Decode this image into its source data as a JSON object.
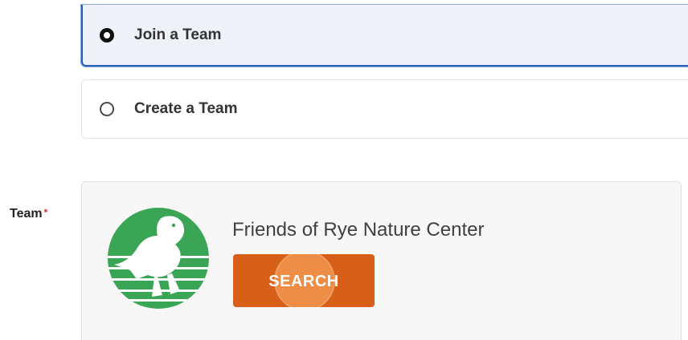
{
  "team_type": {
    "options": [
      {
        "label": "Join a Team",
        "selected": true
      },
      {
        "label": "Create a Team",
        "selected": false
      }
    ]
  },
  "team_field": {
    "label": "Team",
    "required_marker": "*",
    "team_name": "Friends of Rye Nature Center",
    "logo_icon": "bird-on-striped-circle-logo",
    "search_label": "SEARCH"
  },
  "colors": {
    "selected_border": "#2a61b6",
    "search_button": "#d85f18",
    "logo_green": "#3aa655",
    "required_star": "#d0312d"
  }
}
